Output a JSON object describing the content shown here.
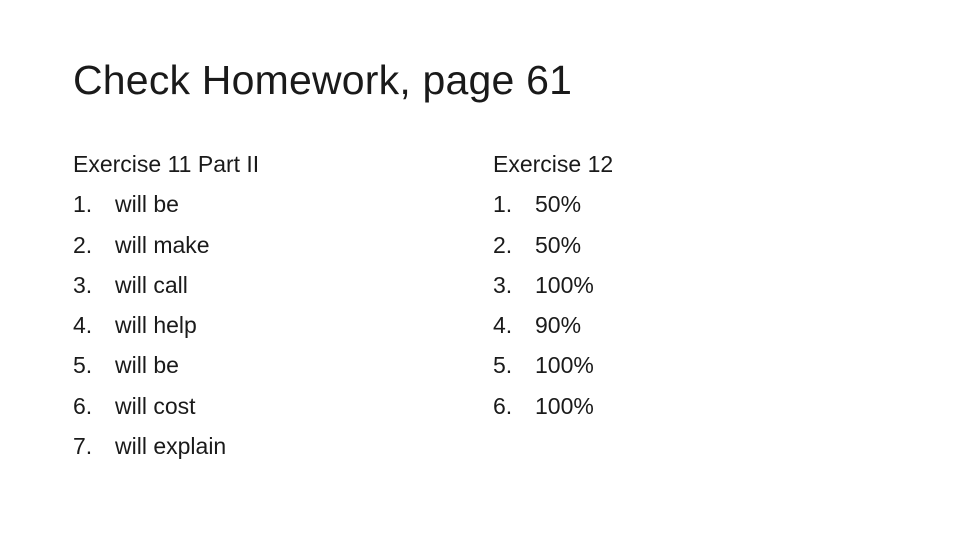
{
  "title": "Check Homework, page 61",
  "left_column": {
    "heading": "Exercise 11 Part II",
    "items": [
      {
        "num": "1.",
        "text": "will be"
      },
      {
        "num": "2.",
        "text": "will make"
      },
      {
        "num": "3.",
        "text": "will call"
      },
      {
        "num": "4.",
        "text": "will help"
      },
      {
        "num": "5.",
        "text": "will be"
      },
      {
        "num": "6.",
        "text": "will cost"
      },
      {
        "num": "7.",
        "text": "will explain"
      }
    ]
  },
  "right_column": {
    "heading": "Exercise 12",
    "items": [
      {
        "num": "1.",
        "text": "50%"
      },
      {
        "num": "2.",
        "text": "50%"
      },
      {
        "num": "3.",
        "text": "100%"
      },
      {
        "num": "4.",
        "text": "90%"
      },
      {
        "num": "5.",
        "text": "100%"
      },
      {
        "num": "6.",
        "text": "100%"
      }
    ]
  }
}
